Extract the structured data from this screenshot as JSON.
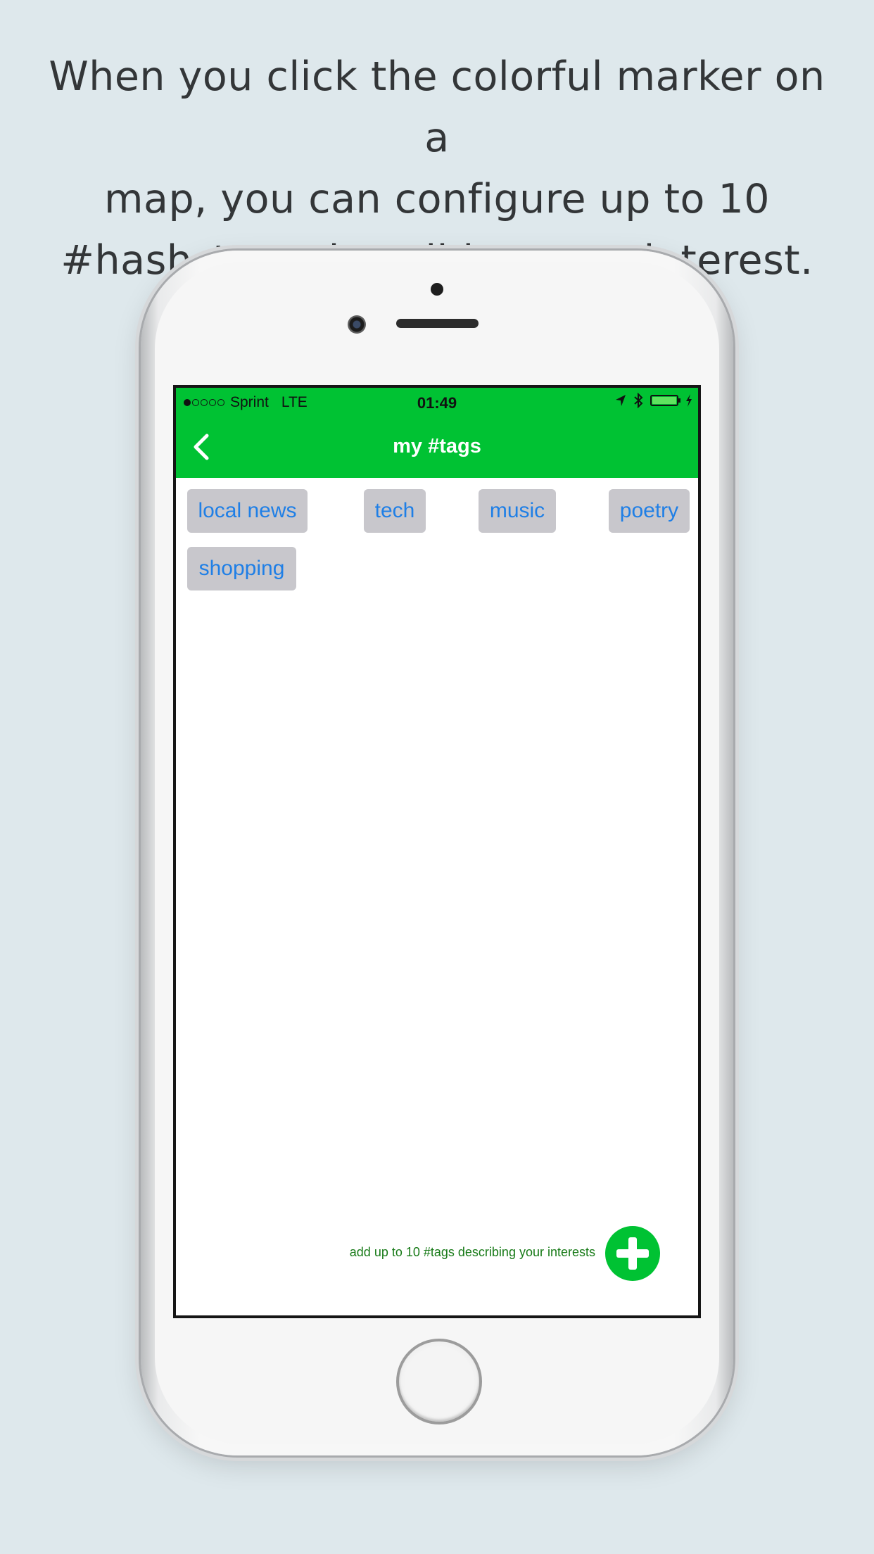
{
  "caption": {
    "line1": "When you click the colorful marker on a",
    "line2": "map, you can configure up to 10",
    "line3": "#hash_tags describing your interest."
  },
  "status_bar": {
    "carrier": "Sprint",
    "network": "LTE",
    "time": "01:49",
    "signal_bars_filled": 1,
    "signal_bars_total": 5,
    "battery_level": 1.0
  },
  "nav": {
    "title": "my #tags",
    "back_icon": "chevron-left-icon"
  },
  "tags": [
    "local news",
    "tech",
    "music",
    "poetry",
    "shopping"
  ],
  "footer": {
    "hint": "add up to 10 #tags describing your interests",
    "add_icon": "plus-icon"
  },
  "colors": {
    "accent_green": "#00c233",
    "tag_background": "#c8c7cc",
    "tag_text": "#1f7fe6",
    "hint_text": "#177a17",
    "background": "#dee8ec"
  }
}
